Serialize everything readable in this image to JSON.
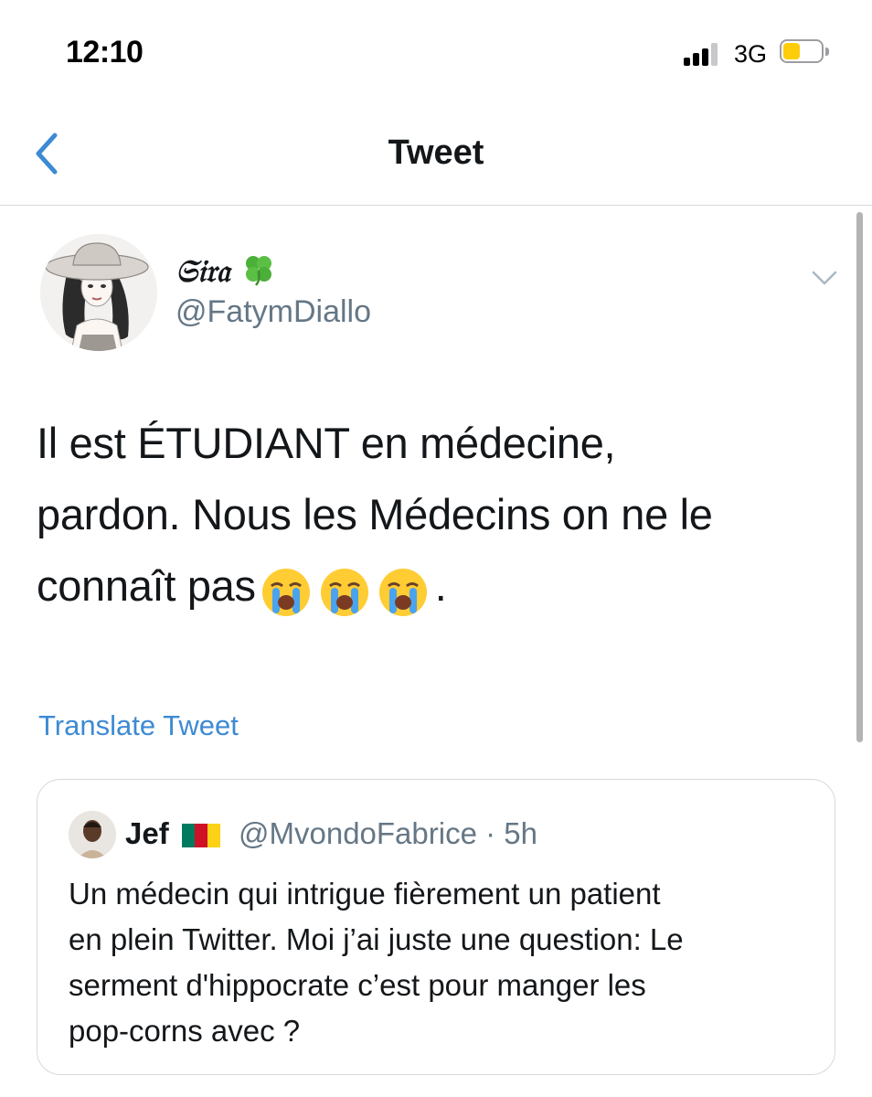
{
  "status_bar": {
    "time": "12:10",
    "network": "3G",
    "signal_bars": 3,
    "signal_bars_total": 4,
    "battery_level": 0.45,
    "battery_color": "#fecd0a"
  },
  "nav": {
    "title": "Tweet",
    "back_icon": "chevron-left-icon",
    "accent_color": "#3d8ad4"
  },
  "tweet": {
    "author": {
      "display_name": "𝔖𝔦𝔯𝔞",
      "name_emoji": "four-leaf-clover-icon",
      "handle": "@FatymDiallo"
    },
    "text_lines": [
      "Il est ÉTUDIANT en médecine,",
      "pardon.  Nous les Médecins on ne le",
      "connaît pas"
    ],
    "emojis": [
      "loudly-crying-face-icon",
      "loudly-crying-face-icon",
      "loudly-crying-face-icon"
    ],
    "text_end": ".",
    "translate_label": "Translate Tweet",
    "menu_icon": "chevron-down-icon"
  },
  "quoted_tweet": {
    "author_name": "Jef",
    "flag": "cameroon-flag-icon",
    "flag_colors": [
      "#007a5e",
      "#ce1126",
      "#fcd116"
    ],
    "meta": "@MvondoFabrice · 5h",
    "text_lines": [
      "Un médecin qui intrigue fièrement un patient",
      "en plein Twitter. Moi j’ai juste une question: Le",
      "serment d'hippocrate c’est pour manger les",
      "pop-corns avec ?"
    ]
  }
}
